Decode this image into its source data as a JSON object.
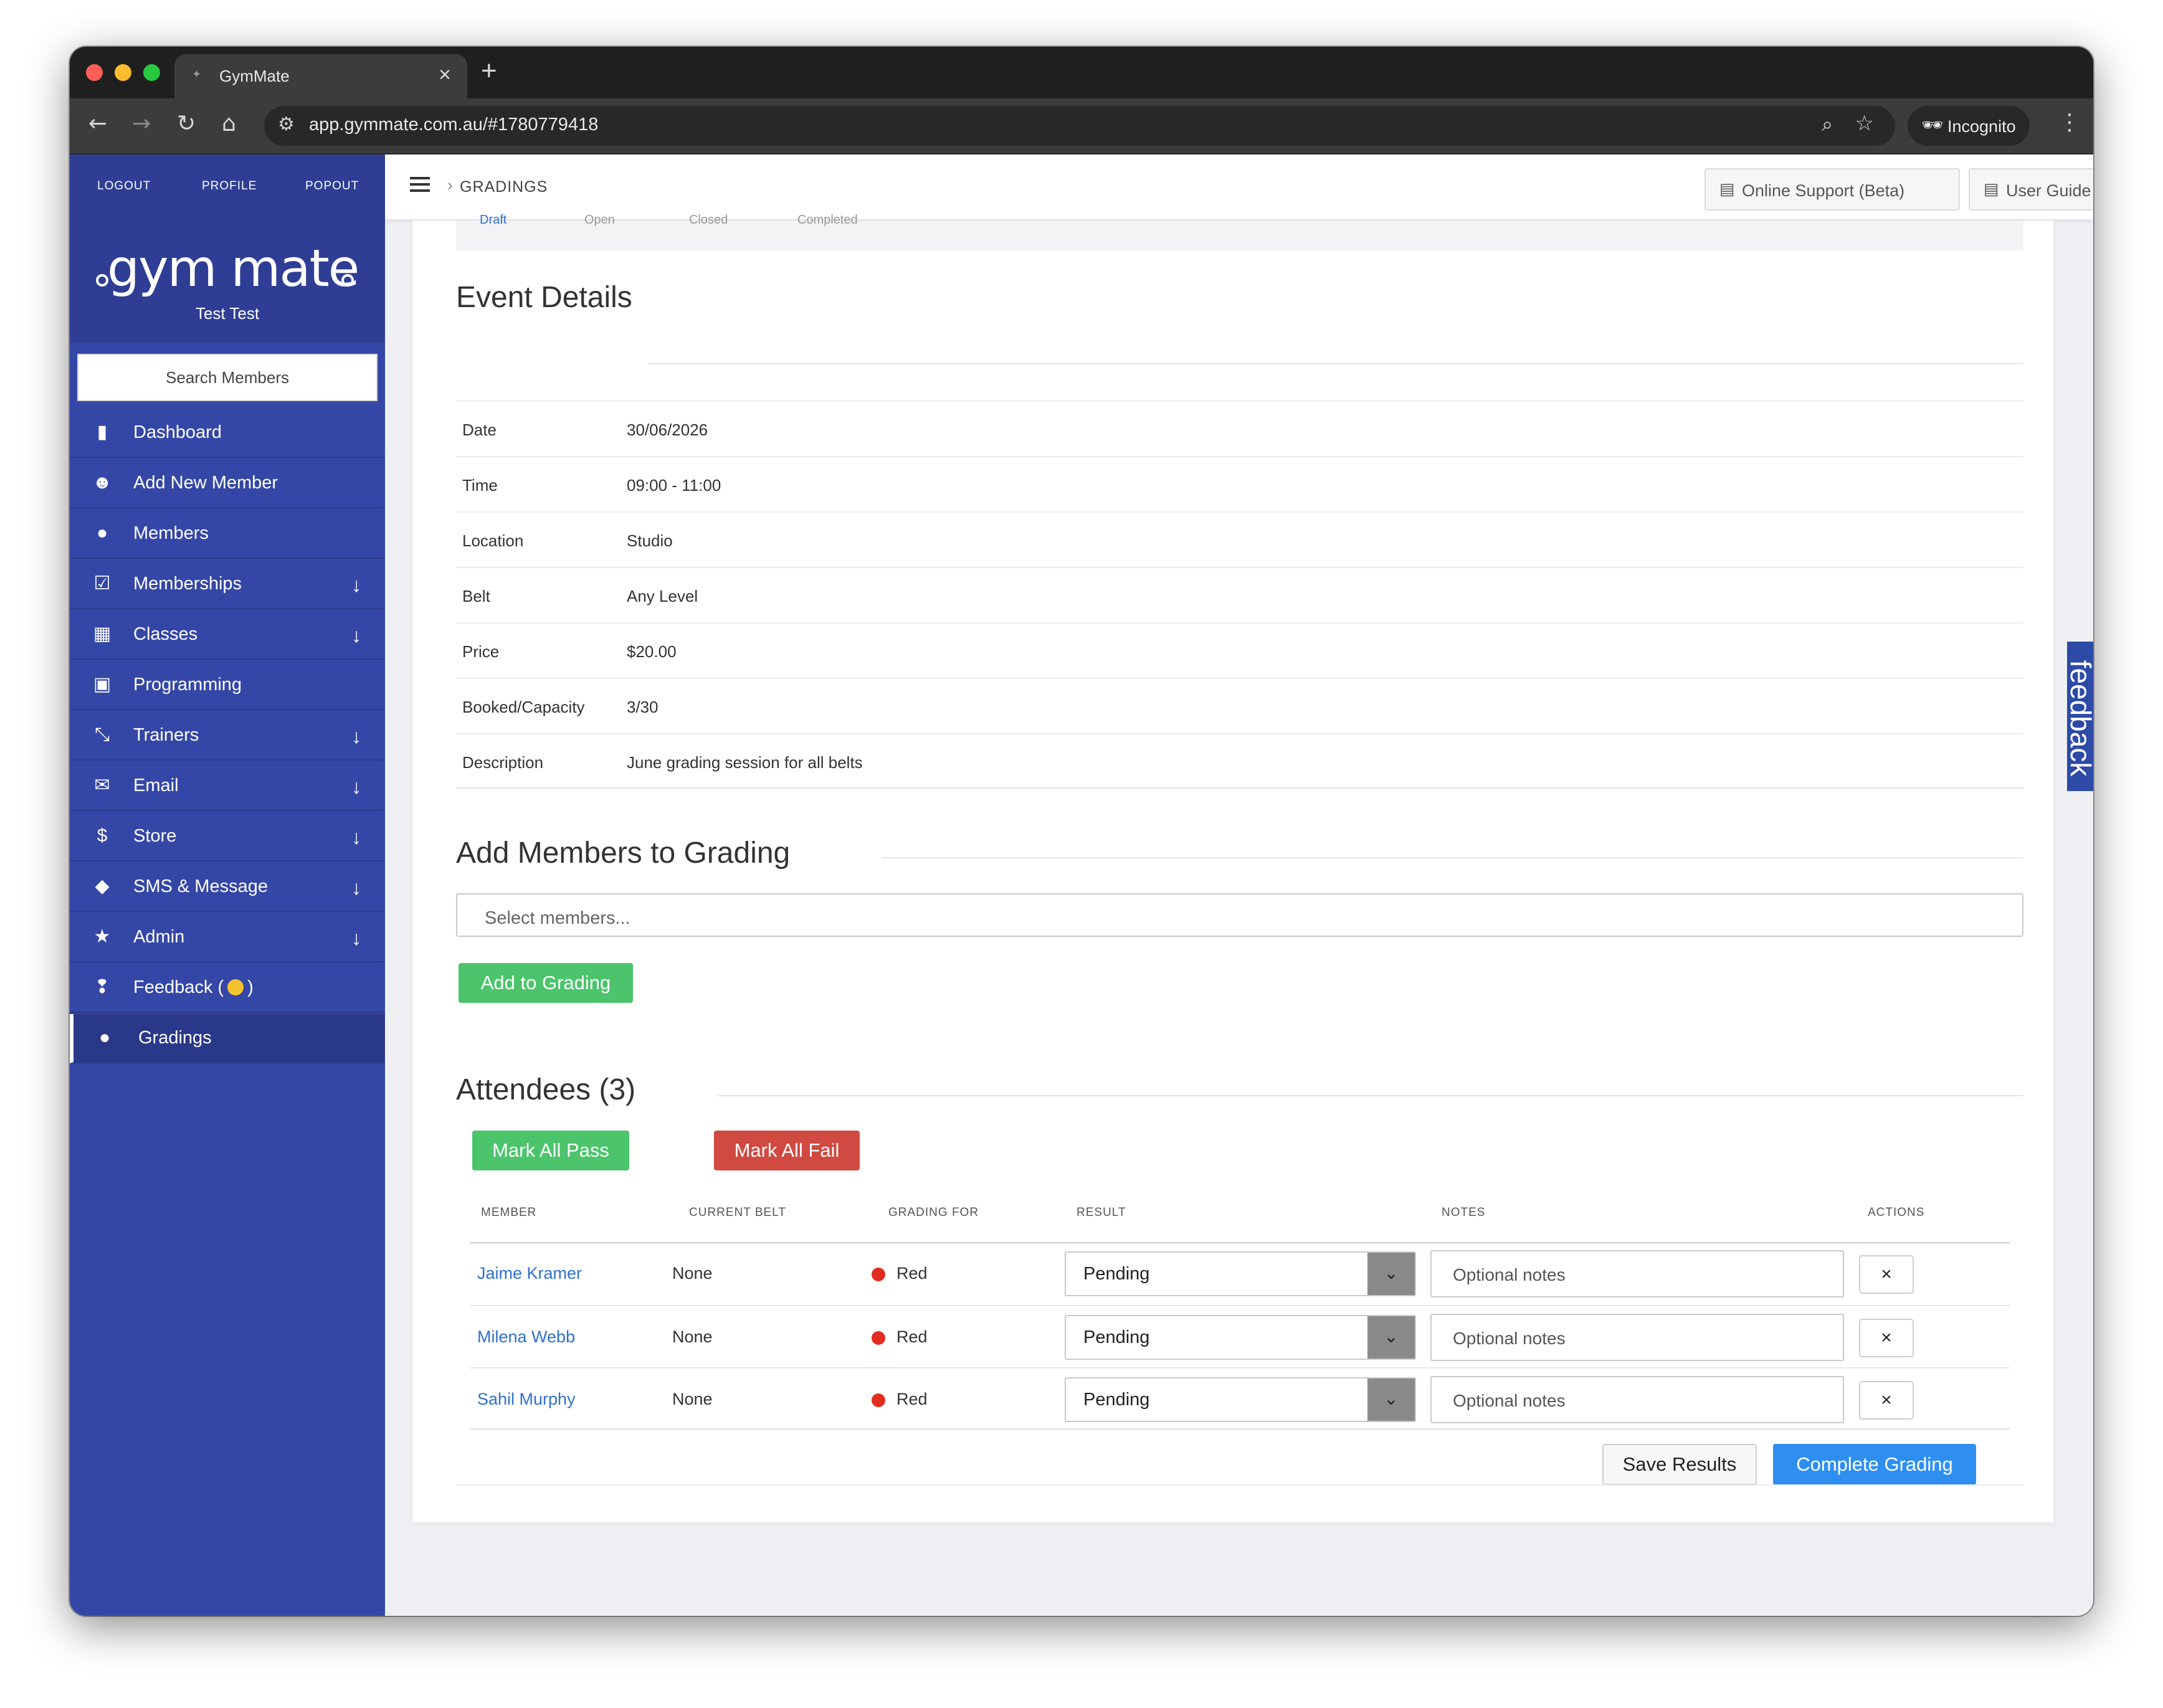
{
  "browser": {
    "tab_title": "GymMate",
    "tab_close": "×",
    "new_tab": "+",
    "url": "app.gymmate.com.au/#1780779418",
    "incognito_label": "Incognito",
    "traffic_colors": [
      "#ff5f57",
      "#febc2e",
      "#28c840"
    ]
  },
  "sidebar": {
    "top_links": [
      "LOGOUT",
      "PROFILE",
      "POPOUT"
    ],
    "logo_text": "gym mate",
    "user_name": "Test Test",
    "search_label": "Search Members",
    "items": [
      {
        "label": "Dashboard",
        "icon": "bar-chart-icon",
        "expandable": false
      },
      {
        "label": "Add New Member",
        "icon": "add-user-icon",
        "expandable": false
      },
      {
        "label": "Members",
        "icon": "user-icon",
        "expandable": false
      },
      {
        "label": "Memberships",
        "icon": "checkbox-icon",
        "expandable": true
      },
      {
        "label": "Classes",
        "icon": "calendar-icon",
        "expandable": true
      },
      {
        "label": "Programming",
        "icon": "clipboard-icon",
        "expandable": false
      },
      {
        "label": "Trainers",
        "icon": "trainers-icon",
        "expandable": true
      },
      {
        "label": "Email",
        "icon": "envelope-icon",
        "expandable": true
      },
      {
        "label": "Store",
        "icon": "shopping-bag-icon",
        "expandable": true
      },
      {
        "label": "SMS & Message",
        "icon": "tag-icon",
        "expandable": true
      },
      {
        "label": "Admin",
        "icon": "star-icon",
        "expandable": true
      },
      {
        "label": "Feedback (",
        "label_suffix": ")",
        "icon": "feedback-icon",
        "expandable": false
      },
      {
        "label": "Gradings",
        "icon": "user-icon",
        "expandable": false,
        "active": true
      }
    ]
  },
  "header": {
    "breadcrumb": "GRADINGS",
    "support_button": "Online Support (Beta)",
    "guide_button": "User Guide"
  },
  "status_steps": [
    "Draft",
    "Open",
    "Closed",
    "Completed"
  ],
  "event_details": {
    "title": "Event Details",
    "rows": [
      {
        "key": "Date",
        "value": "30/06/2026"
      },
      {
        "key": "Time",
        "value": "09:00 - 11:00"
      },
      {
        "key": "Location",
        "value": "Studio"
      },
      {
        "key": "Belt",
        "value": "Any Level"
      },
      {
        "key": "Price",
        "value": "$20.00"
      },
      {
        "key": "Booked/Capacity",
        "value": "3/30"
      },
      {
        "key": "Description",
        "value": "June grading session for all belts"
      }
    ]
  },
  "add_members": {
    "title": "Add Members to Grading",
    "placeholder": "Select members...",
    "button": "Add to Grading"
  },
  "attendees": {
    "title": "Attendees (3)",
    "mark_all_pass": "Mark All Pass",
    "mark_all_fail": "Mark All Fail",
    "columns": [
      "MEMBER",
      "CURRENT BELT",
      "GRADING FOR",
      "RESULT",
      "NOTES",
      "ACTIONS"
    ],
    "rows": [
      {
        "member": "Jaime Kramer",
        "current_belt": "None",
        "grading_for": "Red",
        "result": "Pending",
        "notes_placeholder": "Optional notes",
        "remove": "×"
      },
      {
        "member": "Milena Webb",
        "current_belt": "None",
        "grading_for": "Red",
        "result": "Pending",
        "notes_placeholder": "Optional notes",
        "remove": "×"
      },
      {
        "member": "Sahil Murphy",
        "current_belt": "None",
        "grading_for": "Red",
        "result": "Pending",
        "notes_placeholder": "Optional notes",
        "remove": "×"
      }
    ],
    "save_button": "Save Results",
    "complete_button": "Complete Grading"
  },
  "feedback_tab": "feedback",
  "colors": {
    "sidebar": "#3547a6",
    "green": "#4cc46c",
    "red": "#d04a42",
    "blue": "#2f8ff0",
    "link": "#2f6fd0",
    "belt_red": "#e02d20"
  }
}
